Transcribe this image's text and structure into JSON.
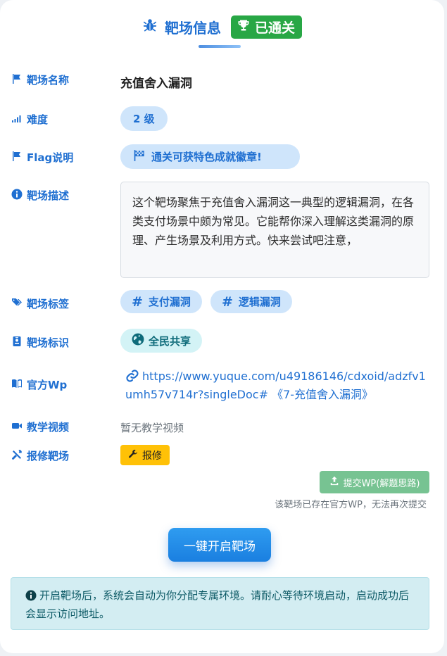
{
  "header": {
    "title": "靶场信息",
    "status_badge": "已通关"
  },
  "fields": {
    "name": {
      "label": "靶场名称",
      "value": "充值舍入漏洞"
    },
    "difficulty": {
      "label": "难度",
      "value": "2 级"
    },
    "flag": {
      "label": "Flag说明",
      "value": "通关可获特色成就徽章!"
    },
    "description": {
      "label": "靶场描述",
      "value": "这个靶场聚焦于充值舍入漏洞这一典型的逻辑漏洞，在各类支付场景中颇为常见。它能帮你深入理解这类漏洞的原理、产生场景及利用方式。快来尝试吧注意，"
    },
    "tags": {
      "label": "靶场标签",
      "items": [
        "支付漏洞",
        "逻辑漏洞"
      ]
    },
    "identity": {
      "label": "靶场标识",
      "value": "全民共享"
    },
    "official_wp": {
      "label": "官方Wp",
      "link_text": "https://www.yuque.com/u49186146/cdxoid/adzfv1umh57v714r?singleDoc# 《7-充值舍入漏洞》"
    },
    "video": {
      "label": "教学视频",
      "value": "暂无教学视频"
    },
    "repair": {
      "label": "报修靶场",
      "button": "报修"
    }
  },
  "submit": {
    "button": "提交WP(解题思路)",
    "note": "该靶场已存在官方WP，无法再次提交"
  },
  "start_button": "一键开启靶场",
  "alert": "开启靶场后，系统会自动为你分配专属环境。请耐心等待环境启动，启动成功后会显示访问地址。",
  "colors": {
    "primary": "#1f6fd1",
    "success": "#28a745",
    "warning": "#ffc107",
    "info_bg": "#d3edf2"
  }
}
